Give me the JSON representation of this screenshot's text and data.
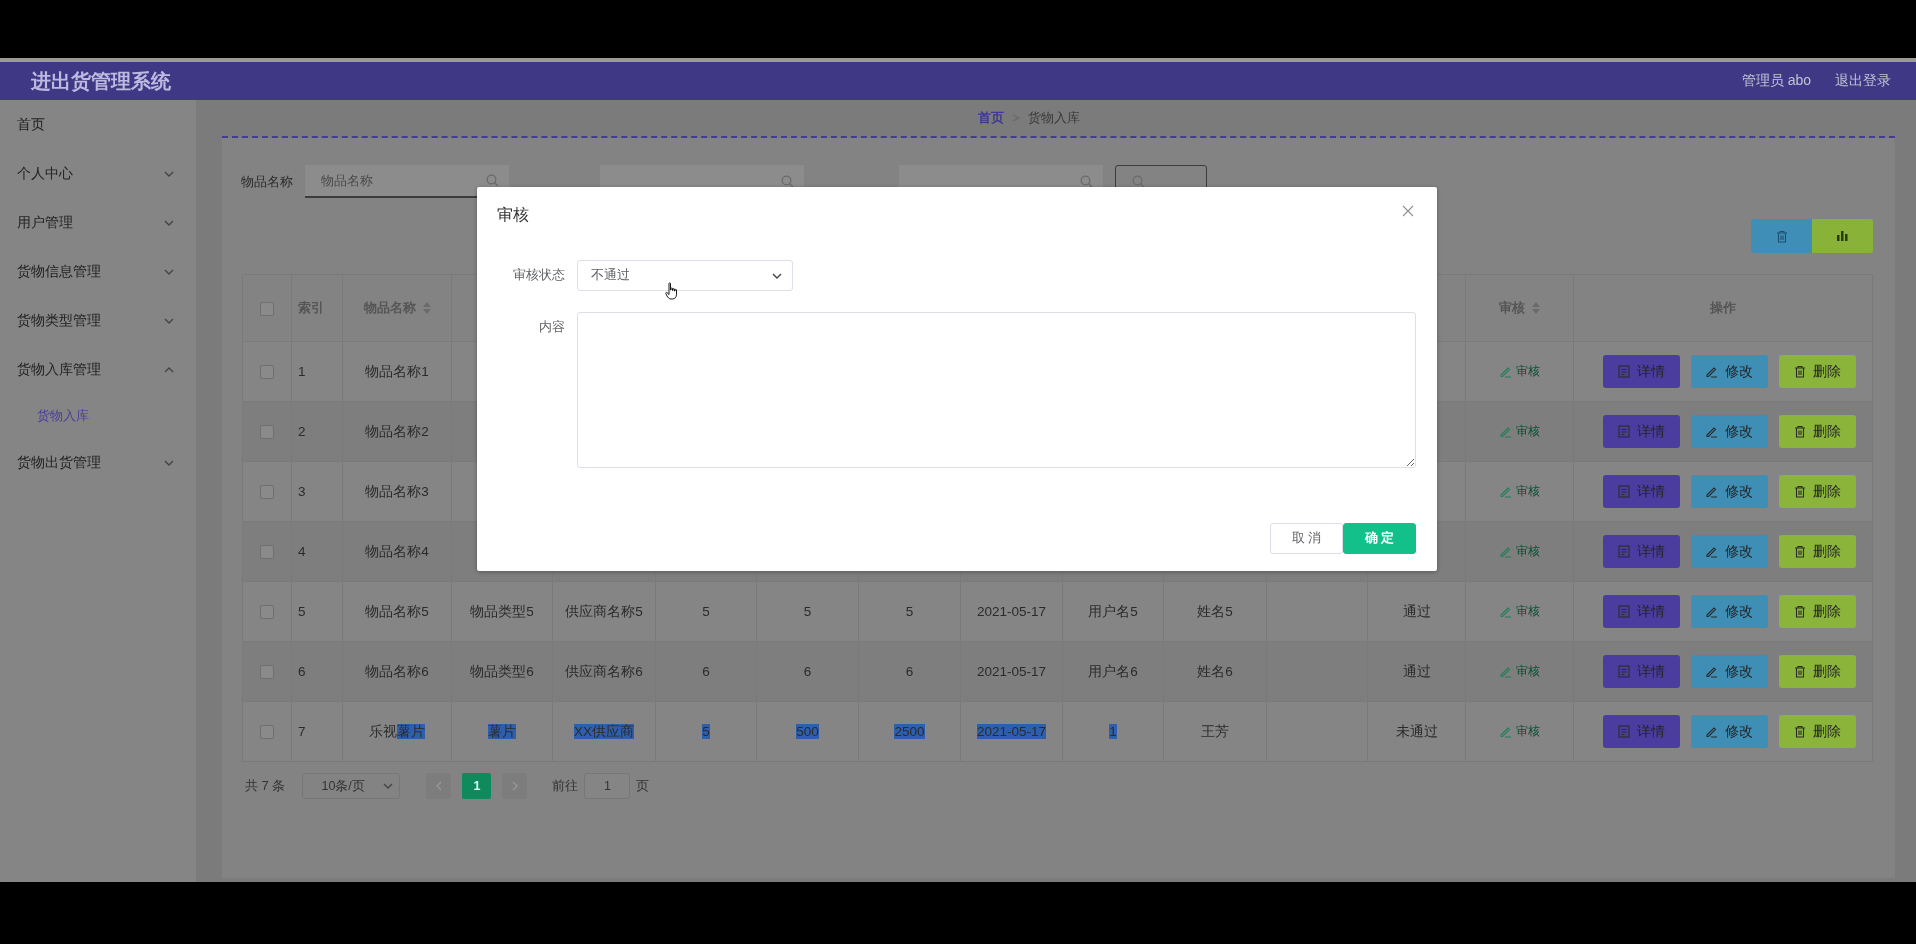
{
  "header": {
    "title": "进出货管理系统",
    "user": "管理员 abo",
    "logout": "退出登录"
  },
  "sidebar": {
    "items": [
      {
        "label": "首页",
        "kind": "link"
      },
      {
        "label": "个人中心",
        "kind": "group",
        "expanded": false
      },
      {
        "label": "用户管理",
        "kind": "group",
        "expanded": false
      },
      {
        "label": "货物信息管理",
        "kind": "group",
        "expanded": false
      },
      {
        "label": "货物类型管理",
        "kind": "group",
        "expanded": false
      },
      {
        "label": "货物入库管理",
        "kind": "group",
        "expanded": true,
        "children": [
          {
            "label": "货物入库",
            "selected": true
          }
        ]
      },
      {
        "label": "货物出货管理",
        "kind": "group",
        "expanded": false
      }
    ]
  },
  "breadcrumb": [
    "首页",
    "货物入库"
  ],
  "search": {
    "label": "物品名称",
    "placeholder": "物品名称"
  },
  "table": {
    "all_checked": false,
    "columns": [
      {
        "label": "索引",
        "sortable": false
      },
      {
        "label": "物品名称",
        "sortable": true
      },
      null,
      null,
      null,
      null,
      null,
      null,
      null,
      null,
      null,
      null,
      {
        "label": "审核",
        "sortable": true
      },
      {
        "label": "操作",
        "sortable": false
      }
    ],
    "rows": [
      {
        "checked": false,
        "cells": [
          "1",
          "物品名称1",
          null,
          null,
          null,
          null,
          null,
          null,
          null,
          null,
          null,
          null
        ],
        "review": "审核",
        "actions": [
          "详情",
          "修改",
          "删除"
        ]
      },
      {
        "checked": false,
        "cells": [
          "2",
          "物品名称2",
          null,
          null,
          null,
          null,
          null,
          null,
          null,
          null,
          null,
          null
        ],
        "review": "审核",
        "actions": [
          "详情",
          "修改",
          "删除"
        ]
      },
      {
        "checked": false,
        "cells": [
          "3",
          "物品名称3",
          null,
          null,
          null,
          null,
          null,
          null,
          null,
          null,
          null,
          null
        ],
        "review": "审核",
        "actions": [
          "详情",
          "修改",
          "删除"
        ]
      },
      {
        "checked": false,
        "cells": [
          "4",
          "物品名称4",
          null,
          null,
          null,
          null,
          null,
          null,
          null,
          null,
          null,
          null
        ],
        "review": "审核",
        "actions": [
          "详情",
          "修改",
          "删除"
        ]
      },
      {
        "checked": false,
        "cells": [
          "5",
          "物品名称5",
          "物品类型5",
          "供应商名称5",
          "5",
          "5",
          "5",
          "2021-05-17",
          "用户名5",
          "姓名5",
          null,
          "通过"
        ],
        "review": "审核",
        "actions": [
          "详情",
          "修改",
          "删除"
        ]
      },
      {
        "checked": false,
        "cells": [
          "6",
          "物品名称6",
          "物品类型6",
          "供应商名称6",
          "6",
          "6",
          "6",
          "2021-05-17",
          "用户名6",
          "姓名6",
          null,
          "通过"
        ],
        "review": "审核",
        "actions": [
          "详情",
          "修改",
          "删除"
        ]
      },
      {
        "checked": false,
        "cells": [
          "7",
          {
            "text": "乐视",
            "selected_text": "薯片"
          },
          {
            "selected_text": "薯片"
          },
          {
            "selected_text": "XX供应商"
          },
          {
            "selected_text": "5"
          },
          {
            "selected_text": "500"
          },
          {
            "selected_text": "2500"
          },
          {
            "selected_text": "2021-05-17"
          },
          {
            "selected_text": "1"
          },
          "王芳",
          null,
          "未通过"
        ],
        "review": "审核",
        "actions": [
          "详情",
          "修改",
          "删除"
        ]
      }
    ],
    "pagination": {
      "total": "共 7 条",
      "page_size": "10条/页",
      "pages": [
        {
          "label": "1",
          "selected": true
        }
      ],
      "goto_label": "前往",
      "goto_value": "1",
      "goto_suffix": "页"
    }
  },
  "modal": {
    "title": "审核",
    "fields": [
      {
        "kind": "select",
        "label": "审核状态",
        "value": "不通过"
      },
      {
        "kind": "textarea",
        "label": "内容"
      }
    ],
    "buttons": [
      {
        "label": "取 消",
        "kind": "default"
      },
      {
        "label": "确 定",
        "kind": "primary"
      }
    ]
  }
}
